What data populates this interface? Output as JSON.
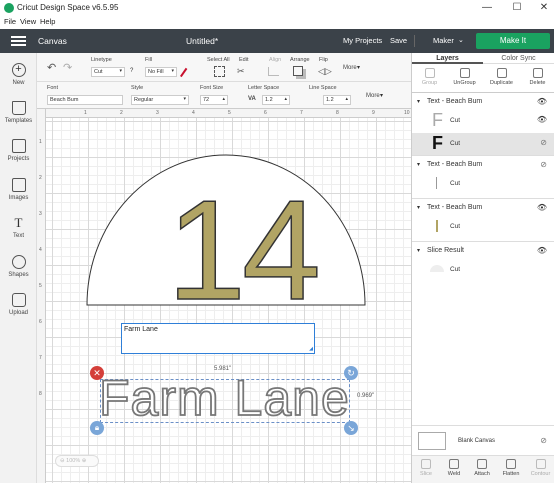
{
  "titlebar": {
    "title": "Cricut Design Space  v6.5.95",
    "minimize": "—",
    "maximize": "☐",
    "close": "✕"
  },
  "menu": {
    "items": [
      "File",
      "View",
      "Help"
    ]
  },
  "header": {
    "canvas_label": "Canvas",
    "doc_title": "Untitled*",
    "my_projects": "My Projects",
    "save": "Save",
    "machine": "Maker",
    "make_it": "Make It",
    "accent": "#1aa260"
  },
  "leftbar": {
    "items": [
      "New",
      "Templates",
      "Projects",
      "Images",
      "Text",
      "Shapes",
      "Upload"
    ]
  },
  "toolbar1": {
    "linetype_label": "Linetype",
    "linetype_value": "Cut",
    "fill_label": "Fill",
    "fill_value": "No Fill",
    "select_all": "Select All",
    "edit": "Edit",
    "align": "Align",
    "arrange": "Arrange",
    "flip": "Flip",
    "more": "More"
  },
  "toolbar2": {
    "font_label": "Font",
    "font_value": "Beach Bum",
    "style_label": "Style",
    "style_value": "Regular",
    "font_size_label": "Font Size",
    "font_size_value": "72",
    "letter_space_label": "Letter Space",
    "letter_space_prefix": "VA",
    "letter_space_value": "1.2",
    "line_space_label": "Line Space",
    "line_space_value": "1.2",
    "more": "More"
  },
  "rulers": {
    "top": [
      "1",
      "2",
      "3",
      "4",
      "5",
      "6",
      "7",
      "8",
      "9",
      "10"
    ],
    "left": [
      "1",
      "2",
      "3",
      "4",
      "5",
      "6",
      "7",
      "8"
    ]
  },
  "canvas": {
    "number_text": "14",
    "textbox_value": "Farm Lane",
    "selected_text": "Farm Lane",
    "width_readout": "5.981\"",
    "height_readout": "0.969\"",
    "zoom": "100%",
    "number_color": "#b1a464"
  },
  "rightpanel": {
    "tabs": [
      "Layers",
      "Color Sync"
    ],
    "tools": [
      "Group",
      "UnGroup",
      "Duplicate",
      "Delete"
    ],
    "layers": [
      {
        "name": "Text - Beach Bum",
        "rows": [
          {
            "label": "Cut",
            "glyph": "F"
          },
          {
            "label": "Cut",
            "glyph": "F"
          }
        ]
      },
      {
        "name": "Text - Beach Bum",
        "rows": [
          {
            "label": "Cut"
          }
        ]
      },
      {
        "name": "Text - Beach Bum",
        "rows": [
          {
            "label": "Cut"
          }
        ]
      },
      {
        "name": "Slice Result",
        "rows": [
          {
            "label": "Cut"
          }
        ]
      }
    ],
    "blank_canvas": "Blank Canvas",
    "bottom_tools": [
      "Slice",
      "Weld",
      "Attach",
      "Flatten",
      "Contour"
    ]
  }
}
